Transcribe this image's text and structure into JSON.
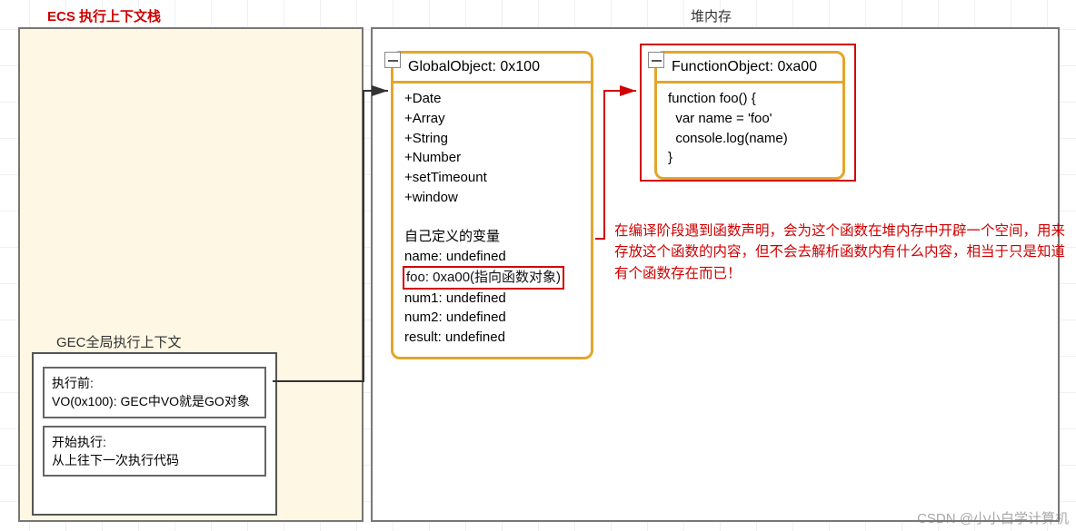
{
  "ecs_title": "ECS 执行上下文栈",
  "heap_title": "堆内存",
  "gec_label": "GEC全局执行上下文",
  "gec_before_title": "执行前:",
  "gec_before_body": "VO(0x100): GEC中VO就是GO对象",
  "gec_after_title": "开始执行:",
  "gec_after_body": "从上往下一次执行代码",
  "globalObject": {
    "title": "GlobalObject: 0x100",
    "builtins": "+Date\n+Array\n+String\n+Number\n+setTimeount\n+window",
    "own_label": "自己定义的变量",
    "own_name": "name: undefined",
    "own_foo": "foo: 0xa00(指向函数对象)",
    "own_rest": "num1: undefined\nnum2: undefined\nresult: undefined"
  },
  "functionObject": {
    "title": "FunctionObject: 0xa00",
    "body": "function foo() {\n  var name = 'foo'\n  console.log(name)\n}"
  },
  "annotation": "在编译阶段遇到函数声明，会为这个函数在堆内存中开辟一个空间，用来存放这个函数的内容，但不会去解析函数内有什么内容，相当于只是知道有个函数存在而已！",
  "watermark": "CSDN @小小白学计算机"
}
